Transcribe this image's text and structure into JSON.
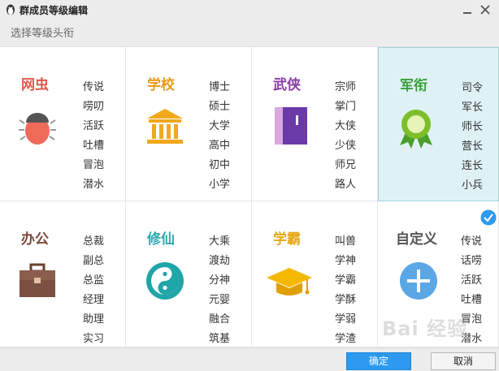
{
  "window": {
    "title": "群成员等级编辑"
  },
  "subheader": {
    "label": "选择等级头衔"
  },
  "cards": [
    {
      "category": "网虫",
      "color": "#e05a4a",
      "icon": "bug-icon",
      "titles": [
        "传说",
        "唠叨",
        "活跃",
        "吐槽",
        "冒泡",
        "潜水"
      ]
    },
    {
      "category": "学校",
      "color": "#e69a1c",
      "icon": "school-building-icon",
      "titles": [
        "博士",
        "硕士",
        "大学",
        "高中",
        "初中",
        "小学"
      ]
    },
    {
      "category": "武侠",
      "color": "#8a3aa6",
      "icon": "martial-book-icon",
      "titles": [
        "宗师",
        "掌门",
        "大侠",
        "少侠",
        "师兄",
        "路人"
      ]
    },
    {
      "category": "军衔",
      "color": "#3aa03a",
      "icon": "medal-icon",
      "titles": [
        "司令",
        "军长",
        "师长",
        "营长",
        "连长",
        "小兵"
      ]
    },
    {
      "category": "办公",
      "color": "#7a4a3a",
      "icon": "briefcase-icon",
      "titles": [
        "总裁",
        "副总",
        "总监",
        "经理",
        "助理",
        "实习"
      ]
    },
    {
      "category": "修仙",
      "color": "#2aa8b0",
      "icon": "yin-yang-icon",
      "titles": [
        "大乘",
        "渡劫",
        "分神",
        "元婴",
        "融合",
        "筑基"
      ]
    },
    {
      "category": "学霸",
      "color": "#e6a817",
      "icon": "graduation-cap-icon",
      "titles": [
        "叫兽",
        "学神",
        "学霸",
        "学酥",
        "学弱",
        "学渣"
      ]
    },
    {
      "category": "自定义",
      "color": "#555555",
      "icon": "plus-circle-icon",
      "titles": [
        "传说",
        "话唠",
        "活跃",
        "吐槽",
        "冒泡",
        "潜水"
      ]
    }
  ],
  "selected_card": "军衔",
  "checked_card": "自定义",
  "footer": {
    "ok_label": "确定",
    "cancel_label": "取消"
  },
  "watermark": "Bai 经验"
}
